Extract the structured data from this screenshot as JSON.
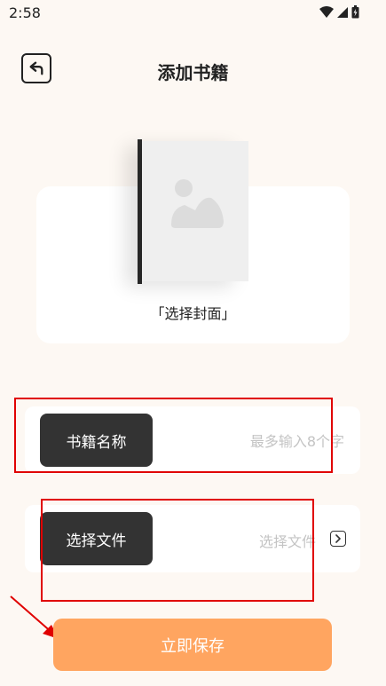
{
  "status_bar": {
    "time": "2:58"
  },
  "header": {
    "title": "添加书籍"
  },
  "cover": {
    "label": "「选择封面」"
  },
  "form": {
    "name_label": "书籍名称",
    "name_placeholder": "最多输入8个字",
    "file_label": "选择文件",
    "file_placeholder": "选择文件"
  },
  "actions": {
    "save_label": "立即保存"
  },
  "colors": {
    "primary": "#ffa560",
    "dark_tag": "#333333",
    "background": "#fdf8f3",
    "annotation": "#e00000"
  }
}
